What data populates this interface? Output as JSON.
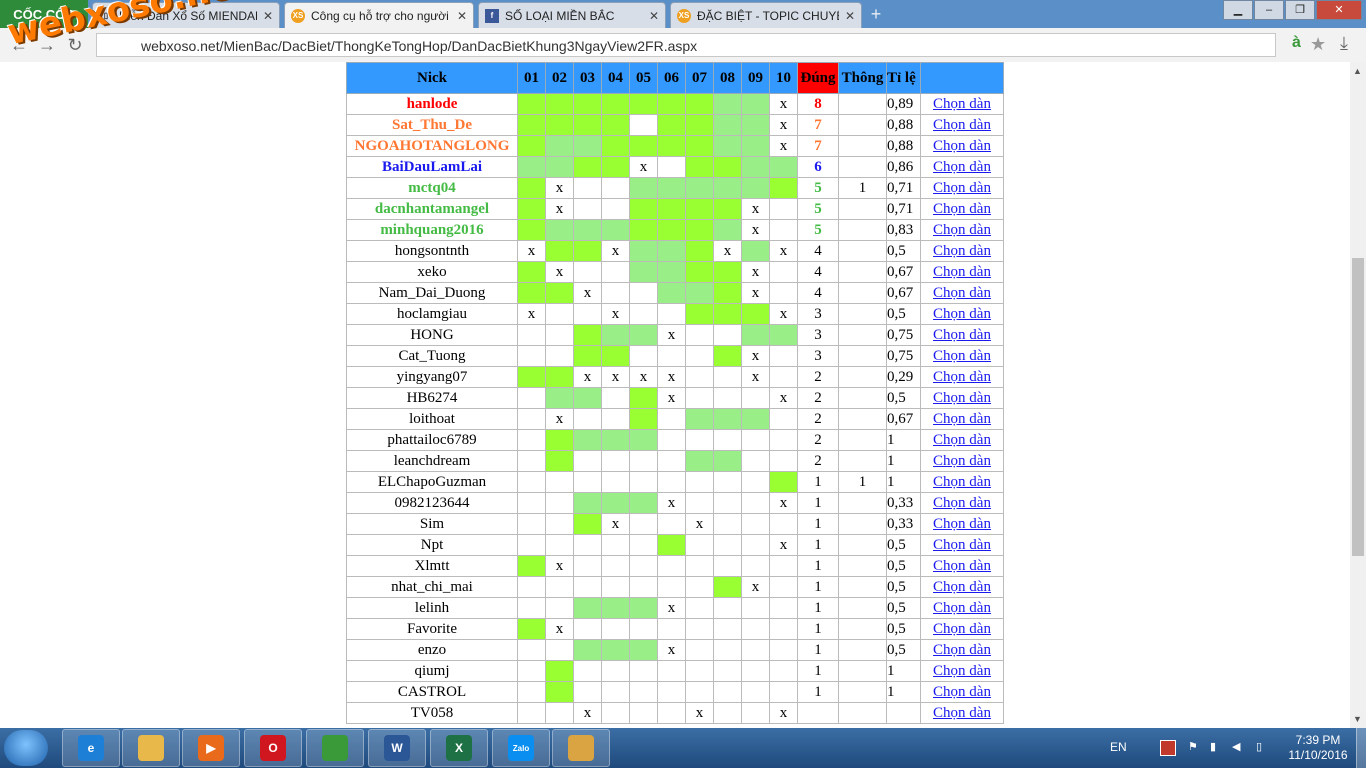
{
  "browser": {
    "brand": "CỐC CỐC",
    "tabs": [
      {
        "label": "Diễn Đàn Xổ Số MIENDAN",
        "icon": "page-icon",
        "active": false
      },
      {
        "label": "Công cụ hỗ trợ cho người",
        "icon": "xs-icon",
        "active": true
      },
      {
        "label": "SỐ LOẠI MIỀN BẮC",
        "icon": "facebook-icon",
        "active": false
      },
      {
        "label": "ĐẶC BIỆT - TOPIC CHUYÊN",
        "icon": "xs-icon",
        "active": false
      }
    ],
    "url": "webxoso.net/MienBac/DacBiet/ThongKeTongHop/DanDacBietKhung3NgayView2FR.aspx",
    "watermark": "webxoso.net"
  },
  "table": {
    "headers": {
      "nick": "Nick",
      "days": [
        "01",
        "02",
        "03",
        "04",
        "05",
        "06",
        "07",
        "08",
        "09",
        "10"
      ],
      "dung": "Đúng",
      "thong": "Thông",
      "tile": "Tỉ lệ"
    },
    "link_label": "Chọn dàn",
    "colors": {
      "green_bright": "#99ff33",
      "green_soft": "#99ee88",
      "header_blue": "#3399ff",
      "dung_red": "#ff0000"
    },
    "rows": [
      {
        "nick": "hanlode",
        "color": "#ff0000",
        "bold": true,
        "cells": [
          "g1",
          "g1",
          "g1",
          "g1",
          "g1",
          "g1",
          "g1",
          "g2",
          "g2",
          "x"
        ],
        "dung": "8",
        "thong": "",
        "tile": "0,89"
      },
      {
        "nick": "Sat_Thu_De",
        "color": "#ff7733",
        "bold": true,
        "cells": [
          "g1",
          "g1",
          "g1",
          "g1",
          "",
          "g1",
          "g1",
          "g2",
          "g2",
          "x"
        ],
        "dung": "7",
        "thong": "",
        "tile": "0,88"
      },
      {
        "nick": "NGOAHOTANGLONG",
        "color": "#ff7733",
        "bold": true,
        "cells": [
          "g1",
          "g2",
          "g2",
          "g1",
          "g1",
          "g1",
          "g1",
          "g2",
          "g2",
          "x"
        ],
        "dung": "7",
        "thong": "",
        "tile": "0,88"
      },
      {
        "nick": "BaiDauLamLai",
        "color": "#1a1aee",
        "bold": true,
        "cells": [
          "g2",
          "g2",
          "g1",
          "g1",
          "x",
          "",
          "g1",
          "g1",
          "g2",
          "g2"
        ],
        "dung": "6",
        "thong": "",
        "tile": "0,86"
      },
      {
        "nick": "mctq04",
        "color": "#44bb44",
        "bold": true,
        "cells": [
          "g1",
          "x",
          "",
          "",
          "g2",
          "g2",
          "g2",
          "g2",
          "g2",
          "g1"
        ],
        "dung": "5",
        "thong": "1",
        "tile": "0,71"
      },
      {
        "nick": "dacnhantamangel",
        "color": "#44bb44",
        "bold": true,
        "cells": [
          "g1",
          "x",
          "",
          "",
          "g1",
          "g1",
          "g1",
          "g1",
          "x",
          ""
        ],
        "dung": "5",
        "thong": "",
        "tile": "0,71"
      },
      {
        "nick": "minhquang2016",
        "color": "#44bb44",
        "bold": true,
        "cells": [
          "g1",
          "g2",
          "g2",
          "g2",
          "g1",
          "g1",
          "g1",
          "g2",
          "x",
          ""
        ],
        "dung": "5",
        "thong": "",
        "tile": "0,83"
      },
      {
        "nick": "hongsontnth",
        "color": "",
        "bold": false,
        "cells": [
          "x",
          "g1",
          "g1",
          "x",
          "g2",
          "g2",
          "g1",
          "x",
          "g2",
          "x"
        ],
        "dung": "4",
        "thong": "",
        "tile": "0,5"
      },
      {
        "nick": "xeko",
        "color": "",
        "bold": false,
        "cells": [
          "g1",
          "x",
          "",
          "",
          "g2",
          "g2",
          "g1",
          "g1",
          "x",
          ""
        ],
        "dung": "4",
        "thong": "",
        "tile": "0,67"
      },
      {
        "nick": "Nam_Dai_Duong",
        "color": "",
        "bold": false,
        "cells": [
          "g1",
          "g1",
          "x",
          "",
          "",
          "g2",
          "g2",
          "g1",
          "x",
          ""
        ],
        "dung": "4",
        "thong": "",
        "tile": "0,67"
      },
      {
        "nick": "hoclamgiau",
        "color": "",
        "bold": false,
        "cells": [
          "x",
          "",
          "",
          "x",
          "",
          "",
          "g1",
          "g1",
          "g1",
          "x"
        ],
        "dung": "3",
        "thong": "",
        "tile": "0,5"
      },
      {
        "nick": "HONG",
        "color": "",
        "bold": false,
        "cells": [
          "",
          "",
          "g1",
          "g2",
          "g2",
          "x",
          "",
          "",
          "g2",
          "g2"
        ],
        "dung": "3",
        "thong": "",
        "tile": "0,75"
      },
      {
        "nick": "Cat_Tuong",
        "color": "",
        "bold": false,
        "cells": [
          "",
          "",
          "g1",
          "g1",
          "",
          "",
          "",
          "g1",
          "x",
          ""
        ],
        "dung": "3",
        "thong": "",
        "tile": "0,75"
      },
      {
        "nick": "yingyang07",
        "color": "",
        "bold": false,
        "cells": [
          "g1",
          "g1",
          "x",
          "x",
          "x",
          "x",
          "",
          "",
          "x",
          ""
        ],
        "dung": "2",
        "thong": "",
        "tile": "0,29"
      },
      {
        "nick": "HB6274",
        "color": "",
        "bold": false,
        "cells": [
          "",
          "g2",
          "g2",
          "",
          "g1",
          "x",
          "",
          "",
          "",
          "x"
        ],
        "dung": "2",
        "thong": "",
        "tile": "0,5"
      },
      {
        "nick": "loithoat",
        "color": "",
        "bold": false,
        "cells": [
          "",
          "x",
          "",
          "",
          "g1",
          "",
          "g2",
          "g2",
          "g2",
          ""
        ],
        "dung": "2",
        "thong": "",
        "tile": "0,67"
      },
      {
        "nick": "phattailoc6789",
        "color": "",
        "bold": false,
        "cells": [
          "",
          "g1",
          "g2",
          "g2",
          "g2",
          "",
          "",
          "",
          "",
          ""
        ],
        "dung": "2",
        "thong": "",
        "tile": "1"
      },
      {
        "nick": "leanchdream",
        "color": "",
        "bold": false,
        "cells": [
          "",
          "g1",
          "",
          "",
          "",
          "",
          "g2",
          "g2",
          "",
          ""
        ],
        "dung": "2",
        "thong": "",
        "tile": "1"
      },
      {
        "nick": "ELChapoGuzman",
        "color": "",
        "bold": false,
        "cells": [
          "",
          "",
          "",
          "",
          "",
          "",
          "",
          "",
          "",
          "g1"
        ],
        "dung": "1",
        "thong": "1",
        "tile": "1"
      },
      {
        "nick": "0982123644",
        "color": "",
        "bold": false,
        "cells": [
          "",
          "",
          "g2",
          "g2",
          "g2",
          "x",
          "",
          "",
          "",
          "x"
        ],
        "dung": "1",
        "thong": "",
        "tile": "0,33"
      },
      {
        "nick": "Sim",
        "color": "",
        "bold": false,
        "cells": [
          "",
          "",
          "g1",
          "x",
          "",
          "",
          "x",
          "",
          "",
          ""
        ],
        "dung": "1",
        "thong": "",
        "tile": "0,33"
      },
      {
        "nick": "Npt",
        "color": "",
        "bold": false,
        "cells": [
          "",
          "",
          "",
          "",
          "",
          "g1",
          "",
          "",
          "",
          "x"
        ],
        "dung": "1",
        "thong": "",
        "tile": "0,5"
      },
      {
        "nick": "Xlmtt",
        "color": "",
        "bold": false,
        "cells": [
          "g1",
          "x",
          "",
          "",
          "",
          "",
          "",
          "",
          "",
          ""
        ],
        "dung": "1",
        "thong": "",
        "tile": "0,5"
      },
      {
        "nick": "nhat_chi_mai",
        "color": "",
        "bold": false,
        "cells": [
          "",
          "",
          "",
          "",
          "",
          "",
          "",
          "g1",
          "x",
          ""
        ],
        "dung": "1",
        "thong": "",
        "tile": "0,5"
      },
      {
        "nick": "lelinh",
        "color": "",
        "bold": false,
        "cells": [
          "",
          "",
          "g2",
          "g2",
          "g2",
          "x",
          "",
          "",
          "",
          ""
        ],
        "dung": "1",
        "thong": "",
        "tile": "0,5"
      },
      {
        "nick": "Favorite",
        "color": "",
        "bold": false,
        "cells": [
          "g1",
          "x",
          "",
          "",
          "",
          "",
          "",
          "",
          "",
          ""
        ],
        "dung": "1",
        "thong": "",
        "tile": "0,5"
      },
      {
        "nick": "enzo",
        "color": "",
        "bold": false,
        "cells": [
          "",
          "",
          "g2",
          "g2",
          "g2",
          "x",
          "",
          "",
          "",
          ""
        ],
        "dung": "1",
        "thong": "",
        "tile": "0,5"
      },
      {
        "nick": "qiumj",
        "color": "",
        "bold": false,
        "cells": [
          "",
          "g1",
          "",
          "",
          "",
          "",
          "",
          "",
          "",
          ""
        ],
        "dung": "1",
        "thong": "",
        "tile": "1"
      },
      {
        "nick": "CASTROL",
        "color": "",
        "bold": false,
        "cells": [
          "",
          "g1",
          "",
          "",
          "",
          "",
          "",
          "",
          "",
          ""
        ],
        "dung": "1",
        "thong": "",
        "tile": "1"
      },
      {
        "nick": "TV058",
        "color": "",
        "bold": false,
        "cells": [
          "",
          "",
          "x",
          "",
          "",
          "",
          "x",
          "",
          "",
          "x"
        ],
        "dung": "",
        "thong": "",
        "tile": ""
      }
    ]
  },
  "taskbar": {
    "apps": [
      {
        "name": "internet-explorer-icon",
        "letter": "e",
        "color": "#1e7fd6"
      },
      {
        "name": "file-explorer-icon",
        "letter": "",
        "color": "#e8b94a"
      },
      {
        "name": "media-player-icon",
        "letter": "▶",
        "color": "#e86a1a"
      },
      {
        "name": "opera-icon",
        "letter": "O",
        "color": "#d0161e"
      },
      {
        "name": "coccoc-browser-icon",
        "letter": "",
        "color": "#3a9a3a"
      },
      {
        "name": "word-icon",
        "letter": "W",
        "color": "#2b5797"
      },
      {
        "name": "excel-icon",
        "letter": "X",
        "color": "#1e7145"
      },
      {
        "name": "zalo-icon",
        "letter": "Zalo",
        "color": "#0a8ff0"
      },
      {
        "name": "paint-icon",
        "letter": "",
        "color": "#d9a441"
      }
    ],
    "language": "EN",
    "time": "7:39 PM",
    "date": "11/10/2016"
  }
}
